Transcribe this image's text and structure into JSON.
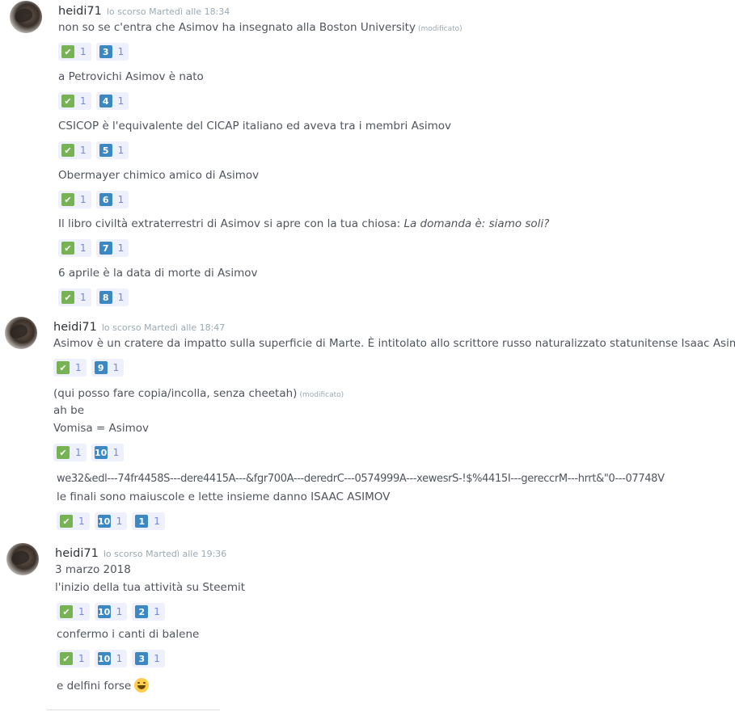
{
  "groups": [
    {
      "author": "heidi71",
      "timestamp": "lo scorso Martedì alle 18:34",
      "messages": [
        {
          "text": "non so se c'entra che Asimov ha insegnato alla Boston University",
          "edited": "(modificato)",
          "reactions": [
            {
              "emoji": "✔",
              "count": "1"
            },
            {
              "emoji": "3",
              "count": "1"
            }
          ]
        },
        {
          "text": "a Petrovichi Asimov è nato",
          "reactions": [
            {
              "emoji": "✔",
              "count": "1"
            },
            {
              "emoji": "4",
              "count": "1"
            }
          ]
        },
        {
          "text": "CSICOP è l'equivalente del CICAP italiano ed aveva tra i membri Asimov",
          "reactions": [
            {
              "emoji": "✔",
              "count": "1"
            },
            {
              "emoji": "5",
              "count": "1"
            }
          ]
        },
        {
          "text": "Obermayer chimico amico di Asimov",
          "reactions": [
            {
              "emoji": "✔",
              "count": "1"
            },
            {
              "emoji": "6",
              "count": "1"
            }
          ]
        },
        {
          "text": "Il libro  civiltà extraterrestri di Asimov si apre con la tua chiosa: ",
          "italic": "La domanda è: siamo soli?",
          "reactions": [
            {
              "emoji": "✔",
              "count": "1"
            },
            {
              "emoji": "7",
              "count": "1"
            }
          ]
        },
        {
          "text": "6 aprile è la data di morte di Asimov",
          "reactions": [
            {
              "emoji": "✔",
              "count": "1"
            },
            {
              "emoji": "8",
              "count": "1"
            }
          ]
        }
      ]
    },
    {
      "author": "heidi71",
      "timestamp": "lo scorso Martedì alle 18:47",
      "messages": [
        {
          "text": "Asimov è un cratere da impatto sulla superficie di Marte. È intitolato allo scrittore russo naturalizzato statunitense Isaac Asimov.",
          "reactions": [
            {
              "emoji": "✔",
              "count": "1"
            },
            {
              "emoji": "9",
              "count": "1"
            }
          ]
        },
        {
          "lines": [
            "(qui posso fare copia/incolla, senza cheetah)",
            "ah be",
            "Vomisa = Asimov"
          ],
          "edited": "(modificato)",
          "reactions": [
            {
              "emoji": "✔",
              "count": "1"
            },
            {
              "emoji": "10",
              "count": "1"
            }
          ]
        },
        {
          "lines": [
            "we32&edl---74fr4458S---dere4415A---&fgr700A---deredrC---0574999A---xewesrS-!$%4415I---gereccrM---hrrt&\"0---07748V",
            "le finali sono maiuscole e lette insieme danno ISAAC ASIMOV"
          ],
          "reactions": [
            {
              "emoji": "✔",
              "count": "1"
            },
            {
              "emoji": "10",
              "count": "1"
            },
            {
              "emoji": "1",
              "count": "1"
            }
          ]
        }
      ]
    },
    {
      "author": "heidi71",
      "timestamp": "lo scorso Martedì alle 19:36",
      "messages": [
        {
          "lines": [
            "3 marzo 2018",
            "l'inizio della tua attività su Steemit"
          ],
          "reactions": [
            {
              "emoji": "✔",
              "count": "1"
            },
            {
              "emoji": "10",
              "count": "1"
            },
            {
              "emoji": "2",
              "count": "1"
            }
          ]
        },
        {
          "text": "confermo i canti di balene",
          "reactions": [
            {
              "emoji": "✔",
              "count": "1"
            },
            {
              "emoji": "10",
              "count": "1"
            },
            {
              "emoji": "3",
              "count": "1"
            }
          ]
        },
        {
          "text": "e delfini forse",
          "emoji_icon": "grinning-face"
        }
      ]
    }
  ]
}
